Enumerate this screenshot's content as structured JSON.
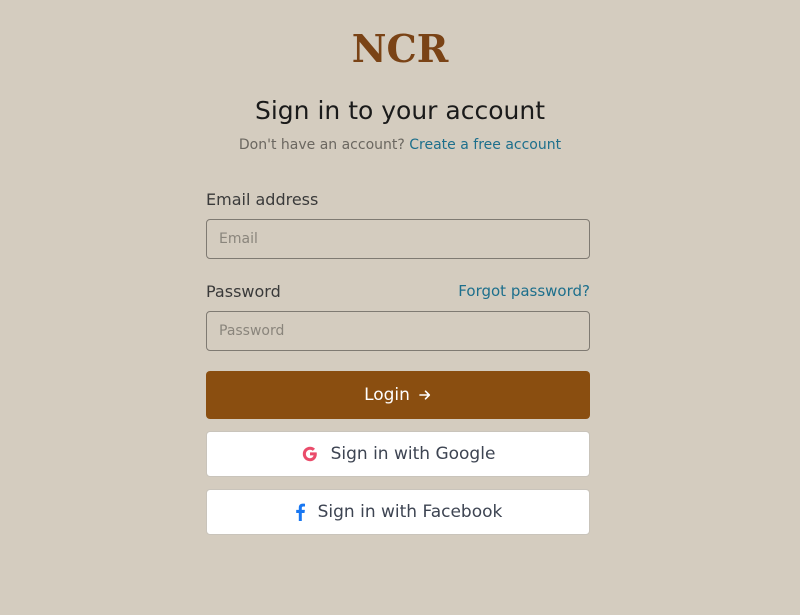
{
  "brand": {
    "logo_text": "NCR"
  },
  "header": {
    "title": "Sign in to your account",
    "subtitle_prefix": "Don't have an account?",
    "create_account_link": "Create a free account"
  },
  "form": {
    "email": {
      "label": "Email address",
      "placeholder": "Email",
      "value": ""
    },
    "password": {
      "label": "Password",
      "placeholder": "Password",
      "value": "",
      "forgot_link": "Forgot password?"
    },
    "login_button": {
      "label": "Login",
      "icon": "arrow-right-icon"
    },
    "google_button": {
      "label": "Sign in with Google",
      "icon": "google-icon"
    },
    "facebook_button": {
      "label": "Sign in with Facebook",
      "icon": "facebook-icon"
    }
  },
  "colors": {
    "background": "#d4ccbf",
    "brand": "#7a4316",
    "primary_button": "#8a4e10",
    "link": "#1d6f8c",
    "google": "#ea4c6b",
    "facebook": "#1877f2"
  }
}
